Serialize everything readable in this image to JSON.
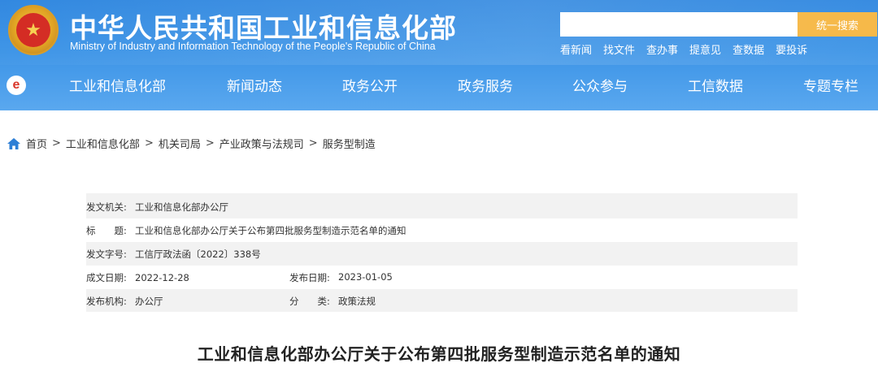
{
  "header": {
    "title_cn": "中华人民共和国工业和信息化部",
    "title_en": "Ministry of Industry and Information Technology of the People's Republic of China",
    "emblem_icon": "national-emblem-icon"
  },
  "search": {
    "placeholder": "",
    "button_label": "统一搜索",
    "button_color": "#f5b53f"
  },
  "quick_links": [
    "看新闻",
    "找文件",
    "查办事",
    "提意见",
    "查数据",
    "要投诉"
  ],
  "nav": {
    "logo_letter": "e",
    "items": [
      "工业和信息化部",
      "新闻动态",
      "政务公开",
      "政务服务",
      "公众参与",
      "工信数据",
      "专题专栏"
    ]
  },
  "breadcrumb": [
    "首页",
    "工业和信息化部",
    "机关司局",
    "产业政策与法规司",
    "服务型制造"
  ],
  "info": {
    "issuer_label": "发文机关:",
    "issuer": "工业和信息化部办公厅",
    "title_label": "标　　题:",
    "title": "工业和信息化部办公厅关于公布第四批服务型制造示范名单的通知",
    "doc_no_label": "发文字号:",
    "doc_no": "工信厅政法函〔2022〕338号",
    "created_label": "成文日期:",
    "created": "2022-12-28",
    "published_label": "发布日期:",
    "published": "2023-01-05",
    "org_label": "发布机构:",
    "org": "办公厅",
    "category_label": "分　　类:",
    "category": "政策法规"
  },
  "document_title": "工业和信息化部办公厅关于公布第四批服务型制造示范名单的通知",
  "colors": {
    "header_blue": "#2e86df",
    "accent_orange": "#f5b53f",
    "info_bg": "#f2f2f2"
  }
}
